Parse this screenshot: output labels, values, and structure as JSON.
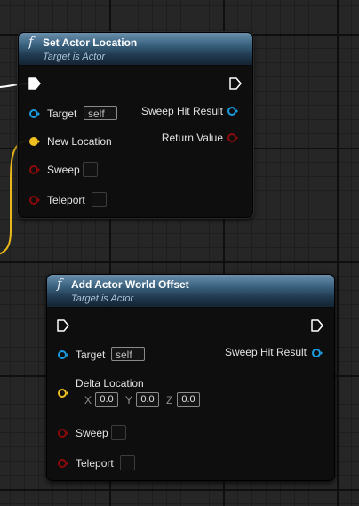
{
  "colors": {
    "exec_pin": "#ffffff",
    "actor_pin": "#1a9bdf",
    "vector_pin": "#f0c020",
    "bool_pin": "#8c0a0a",
    "exec_wire": "#ffffff",
    "vector_wire": "#e8b81a"
  },
  "node1": {
    "icon": "function-icon",
    "fn_symbol": "f",
    "title": "Set Actor Location",
    "subtitle": "Target is Actor",
    "inputs": {
      "target_label": "Target",
      "target_value": "self",
      "new_location_label": "New Location",
      "sweep_label": "Sweep",
      "teleport_label": "Teleport"
    },
    "outputs": {
      "sweep_hit_result_label": "Sweep Hit Result",
      "return_value_label": "Return Value"
    }
  },
  "node2": {
    "icon": "function-icon",
    "fn_symbol": "f",
    "title": "Add Actor World Offset",
    "subtitle": "Target is Actor",
    "inputs": {
      "target_label": "Target",
      "target_value": "self",
      "delta_location_label": "Delta Location",
      "x_label": "X",
      "x_value": "0.0",
      "y_label": "Y",
      "y_value": "0.0",
      "z_label": "Z",
      "z_value": "0.0",
      "sweep_label": "Sweep",
      "teleport_label": "Teleport"
    },
    "outputs": {
      "sweep_hit_result_label": "Sweep Hit Result"
    }
  }
}
